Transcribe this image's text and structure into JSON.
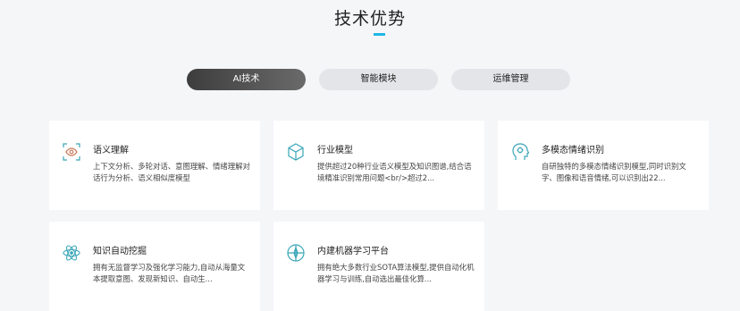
{
  "section": {
    "title": "技术优势"
  },
  "tabs": [
    {
      "label": "AI技术",
      "active": true
    },
    {
      "label": "智能模块",
      "active": false
    },
    {
      "label": "运维管理",
      "active": false
    }
  ],
  "cards": [
    {
      "title": "语义理解",
      "desc": "上下文分析、多轮对话、意图理解、情绪理解对话行为分析、语义相似度模型",
      "icon": "scan-icon"
    },
    {
      "title": "行业模型",
      "desc": "提供超过20种行业语义模型及知识图谱,结合语境精准识别常用问题<br/>超过2...",
      "icon": "cube-icon"
    },
    {
      "title": "多模态情绪识别",
      "desc": "自研独特的多模态情绪识别模型,同时识别文字、图像和语音情绪,可以识别出22...",
      "icon": "head-gear-icon"
    },
    {
      "title": "知识自动挖掘",
      "desc": "拥有无监督学习及强化学习能力,自动从海量文本提取意图、发现新知识、自动生...",
      "icon": "atom-icon"
    },
    {
      "title": "内建机器学习平台",
      "desc": "拥有绝大多数行业SOTA算法模型,提供自动化机器学习与训练,自动选出最佳化算...",
      "icon": "compass-icon"
    }
  ],
  "colors": {
    "accent": "#1fb6e6",
    "icon": "#3aa6b8"
  }
}
